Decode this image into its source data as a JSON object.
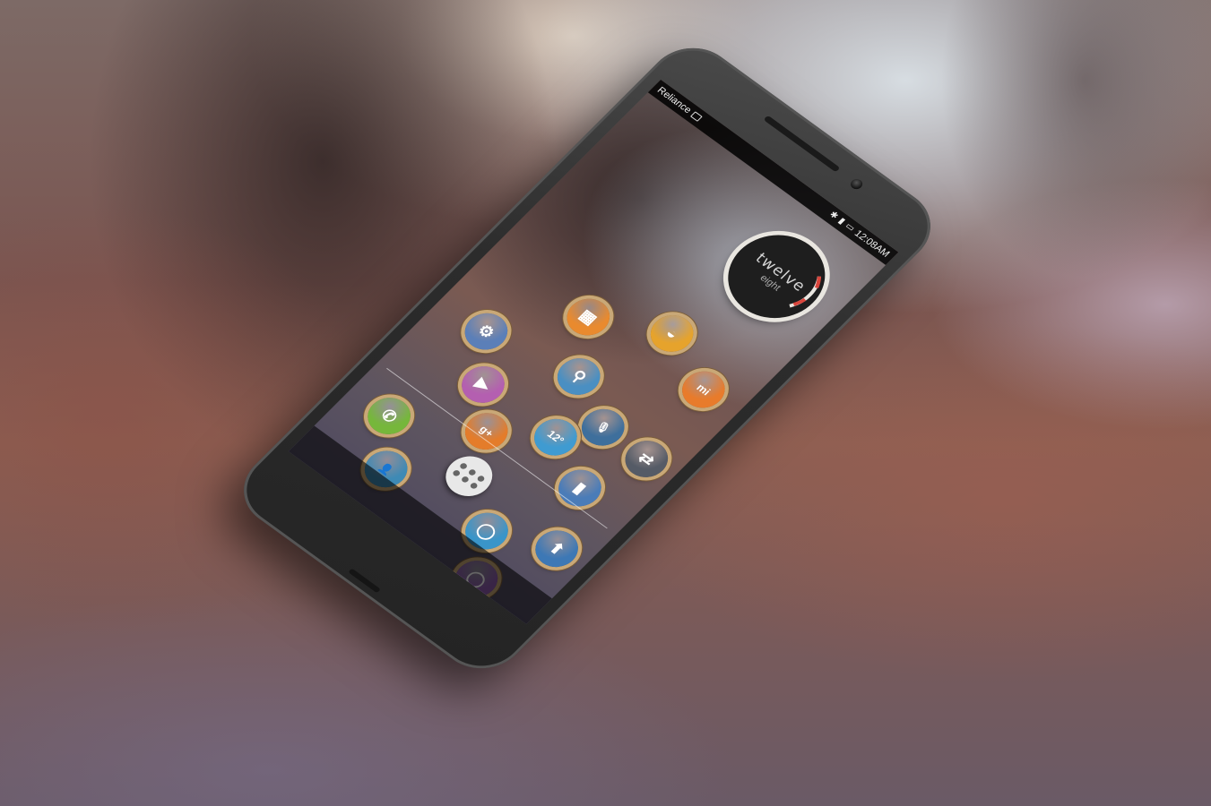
{
  "status_bar": {
    "carrier": "Reliance",
    "time": "12:08AM"
  },
  "clock_widget": {
    "hour_text": "twelve",
    "minute_text": "eight"
  },
  "icons": [
    {
      "name": "settings-icon",
      "color": "#5b7fb8",
      "glyph": "⚙"
    },
    {
      "name": "sim-toolkit-icon",
      "color": "#e98a2e",
      "glyph": "▦"
    },
    {
      "name": "gallery-icon",
      "color": "#e6a32c",
      "glyph": "◒"
    },
    {
      "name": "mi-icon",
      "color": "#e87b2b",
      "glyph": "mi"
    },
    {
      "name": "play-store-icon",
      "color": "#b45fb0",
      "glyph": "▶"
    },
    {
      "name": "search-icon",
      "color": "#4a8fc2",
      "glyph": "⚲"
    },
    {
      "name": "voice-search-icon",
      "color": "#3e6f9c",
      "glyph": "🎙"
    },
    {
      "name": "google-plus-icon",
      "color": "#e47c2a",
      "glyph": "g+"
    },
    {
      "name": "weather-icon",
      "color": "#3f9bd1",
      "glyph": "12°"
    },
    {
      "name": "transfer-icon",
      "color": "#555b66",
      "glyph": "⇄"
    },
    {
      "name": "flashlight-icon",
      "color": "#4a7cb8",
      "glyph": "▮"
    },
    {
      "name": "upload-icon",
      "color": "#3d78b5",
      "glyph": "⬆"
    },
    {
      "name": "phone-icon",
      "color": "#76b73b",
      "glyph": "✆"
    },
    {
      "name": "contacts-icon",
      "color": "#3e8ab5",
      "glyph": "👤"
    },
    {
      "name": "browser-icon",
      "color": "#3a95c9",
      "glyph": "◯"
    },
    {
      "name": "messaging-icon",
      "color": "#8e5bb0",
      "glyph": "◯"
    }
  ],
  "dock": {
    "drawer_label": "apps"
  }
}
